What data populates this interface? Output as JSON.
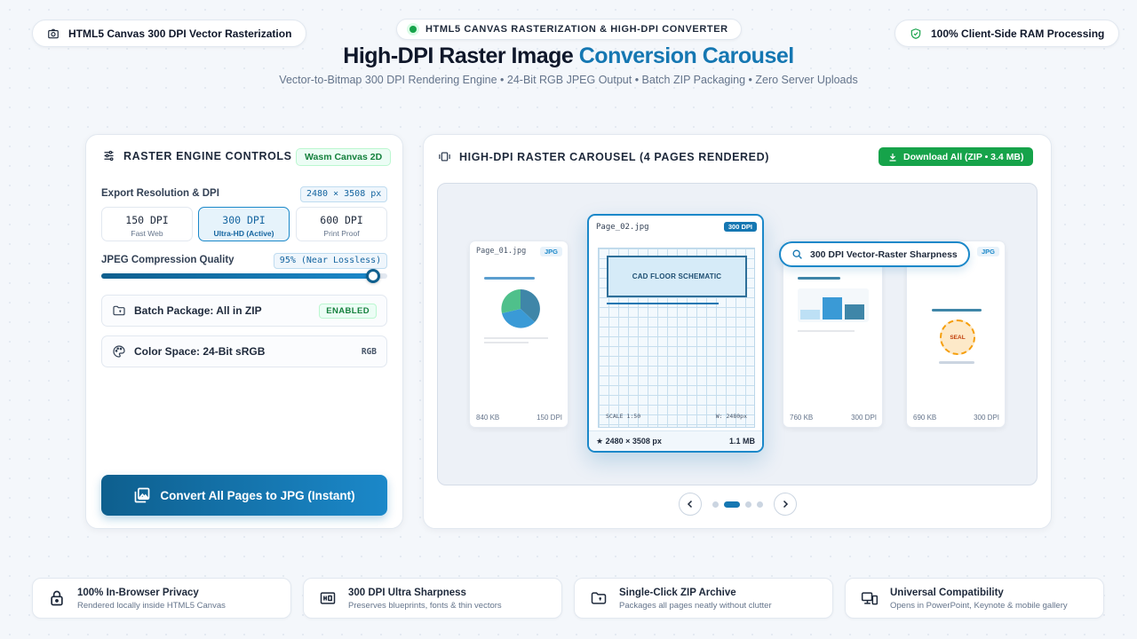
{
  "header": {
    "left_pill": "HTML5 Canvas 300 DPI Vector Rasterization",
    "center_pill": "HTML5 CANVAS RASTERIZATION & HIGH-DPI CONVERTER",
    "right_pill": "100% Client-Side RAM Processing",
    "title_main": "High-DPI Raster Image",
    "title_accent": "Conversion Carousel",
    "subtitle": "Vector-to-Bitmap 300 DPI Rendering Engine • 24-Bit RGB JPEG Output • Batch ZIP Packaging • Zero Server Uploads"
  },
  "controls": {
    "heading": "RASTER ENGINE CONTROLS",
    "engine_badge": "Wasm Canvas 2D",
    "resolution_label": "Export Resolution & DPI",
    "resolution_value": "2480 × 3508 px",
    "dpi_options": [
      {
        "value": "150 DPI",
        "sub": "Fast Web"
      },
      {
        "value": "300 DPI",
        "sub": "Ultra-HD (Active)"
      },
      {
        "value": "600 DPI",
        "sub": "Print Proof"
      }
    ],
    "quality_label": "JPEG Compression Quality",
    "quality_value": "95% (Near Lossless)",
    "quality_level": 0.95,
    "batch_label": "Batch Package: All in ZIP",
    "batch_status": "ENABLED",
    "color_label": "Color Space: 24-Bit sRGB",
    "color_value": "RGB",
    "convert_button": "Convert All Pages to JPG (Instant)"
  },
  "carousel": {
    "heading": "HIGH-DPI RASTER CAROUSEL (4 PAGES RENDERED)",
    "download_button": "Download All (ZIP • 3.4 MB)",
    "pages": [
      {
        "name": "Page_01.jpg",
        "tag": "JPG",
        "size": "840 KB",
        "dpi": "150 DPI"
      },
      {
        "name": "Page_02.jpg",
        "tag": "300 DPI",
        "size": "1.1 MB",
        "dims": "★ 2480 × 3508 px",
        "schematic": "CAD FLOOR SCHEMATIC",
        "scale": "SCALE 1:50",
        "width_note": "W: 2480px"
      },
      {
        "name": "",
        "tag": "",
        "size": "760 KB",
        "dpi": "300 DPI"
      },
      {
        "name": "",
        "tag": "JPG",
        "size": "690 KB",
        "dpi": "300 DPI",
        "seal": "SEAL"
      }
    ],
    "zoom_tooltip": "300 DPI Vector-Raster Sharpness",
    "active_index": 1
  },
  "features": [
    {
      "title": "100% In-Browser Privacy",
      "sub": "Rendered locally inside HTML5 Canvas",
      "icon": "lock-icon"
    },
    {
      "title": "300 DPI Ultra Sharpness",
      "sub": "Preserves blueprints, fonts & thin vectors",
      "icon": "hq-icon"
    },
    {
      "title": "Single-Click ZIP Archive",
      "sub": "Packages all pages neatly without clutter",
      "icon": "folder-icon"
    },
    {
      "title": "Universal Compatibility",
      "sub": "Opens in PowerPoint, Keynote & mobile gallery",
      "icon": "devices-icon"
    }
  ],
  "colors": {
    "accent": "#1577b2",
    "success": "#16a34a",
    "success_dark": "#15803d",
    "text": "#0f172a",
    "muted": "#64748b"
  }
}
